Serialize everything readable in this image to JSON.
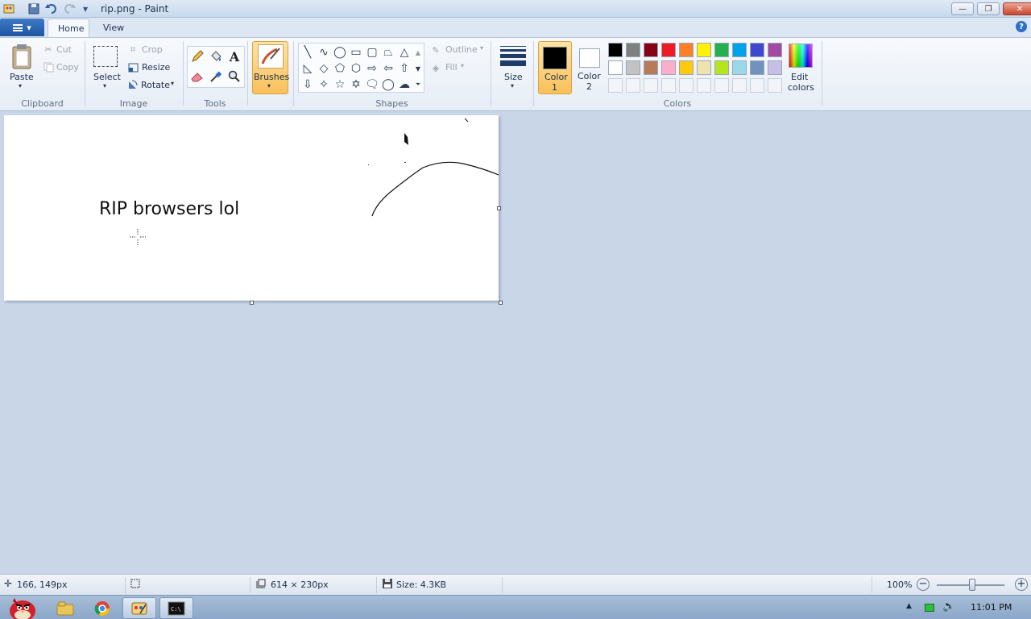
{
  "window": {
    "title": "rip.png - Paint",
    "controls": {
      "minimize": "—",
      "maximize": "❐",
      "close": "✕"
    }
  },
  "quick_access": {
    "icons": [
      "paint-app-icon",
      "save-icon",
      "undo-icon",
      "redo-icon",
      "customize-icon"
    ]
  },
  "tabs": [
    {
      "label": "Home",
      "active": true
    },
    {
      "label": "View",
      "active": false
    }
  ],
  "ribbon": {
    "clipboard": {
      "group": "Clipboard",
      "paste": "Paste",
      "cut": "Cut",
      "copy": "Copy"
    },
    "image": {
      "group": "Image",
      "select": "Select",
      "crop": "Crop",
      "resize": "Resize",
      "rotate": "Rotate"
    },
    "tools": {
      "group": "Tools"
    },
    "brushes": {
      "label": "Brushes"
    },
    "shapes": {
      "group": "Shapes",
      "outline": "Outline",
      "fill": "Fill"
    },
    "size": {
      "label": "Size"
    },
    "colors": {
      "group": "Colors",
      "color1_label": "Color",
      "color1_num": "1",
      "color2_label": "Color",
      "color2_num": "2",
      "color1_value": "#000000",
      "color2_value": "#ffffff",
      "edit_label": "Edit",
      "edit_label2": "colors",
      "palette_row1": [
        "#000000",
        "#7f7f7f",
        "#880015",
        "#ed1c24",
        "#ff7f27",
        "#fff200",
        "#22b14c",
        "#00a2e8",
        "#3f48cc",
        "#a349a4"
      ],
      "palette_row2": [
        "#ffffff",
        "#c3c3c3",
        "#b97a57",
        "#ffaec9",
        "#ffc90e",
        "#efe4b0",
        "#b5e61d",
        "#99d9ea",
        "#7092be",
        "#c8bfe7"
      ]
    }
  },
  "canvas": {
    "text": "RIP browsers lol"
  },
  "status": {
    "cursor_pos": "166, 149px",
    "image_size": "614 × 230px",
    "file_size": "Size: 4.3KB",
    "zoom": "100%"
  },
  "taskbar": {
    "time": "11:01 PM"
  }
}
